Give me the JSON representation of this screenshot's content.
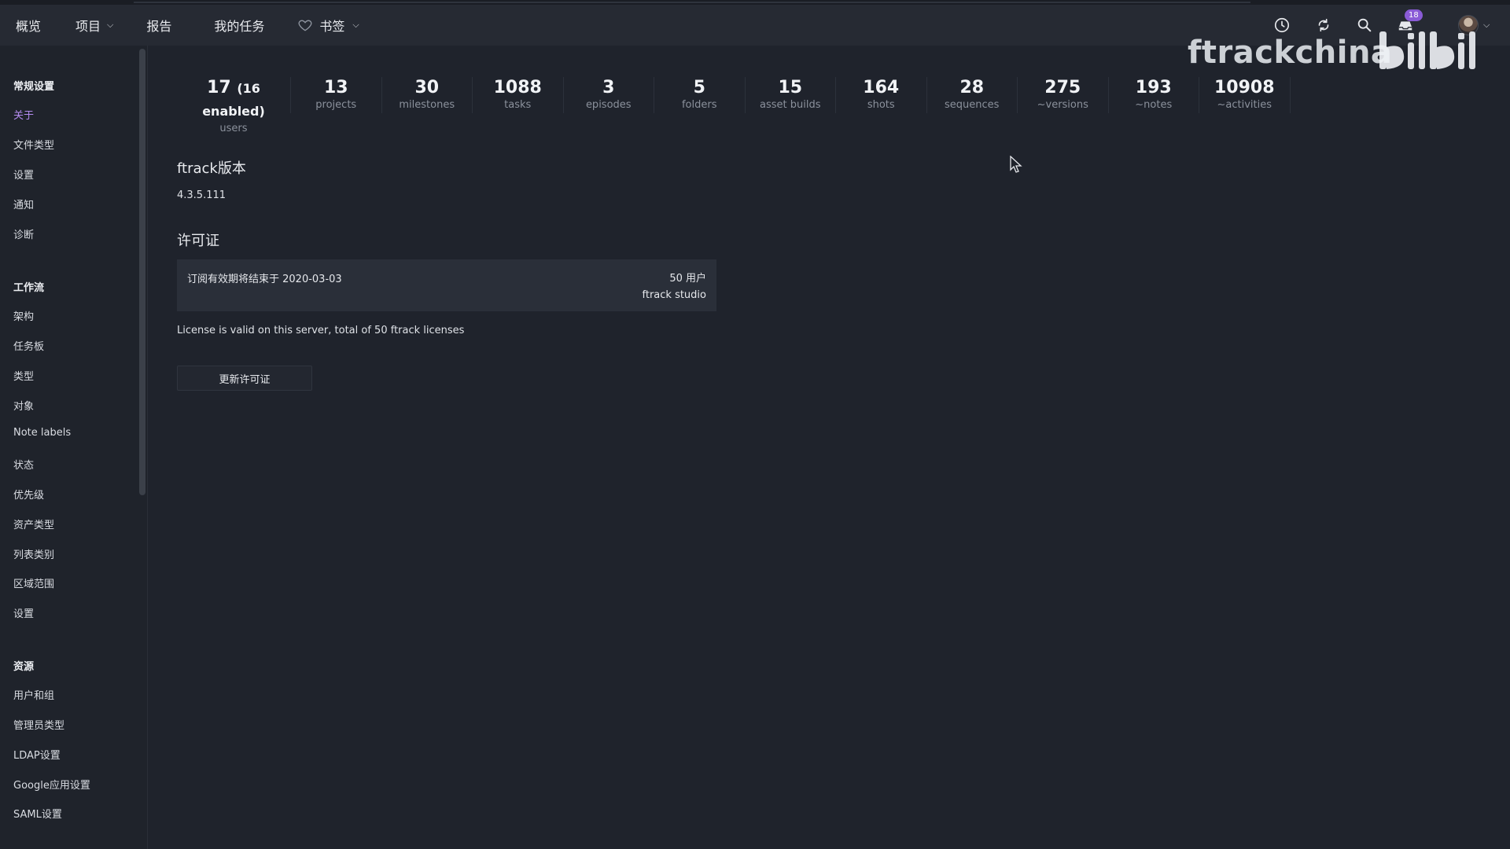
{
  "header": {
    "nav": [
      {
        "label": "概览"
      },
      {
        "label": "项目"
      },
      {
        "label": "报告"
      },
      {
        "label": "我的任务"
      },
      {
        "label": "书签"
      }
    ],
    "inbox_count": "18"
  },
  "watermark": {
    "text": "ftrackchina",
    "logo": "bilibili"
  },
  "sidebar": {
    "sections": [
      {
        "title": "常规设置",
        "items": [
          "关于",
          "文件类型",
          "设置",
          "通知",
          "诊断"
        ]
      },
      {
        "title": "工作流",
        "items": [
          "架构",
          "任务板",
          "类型",
          "对象",
          "Note labels",
          "状态",
          "优先级",
          "资产类型",
          "列表类别",
          "区域范围",
          "设置"
        ]
      },
      {
        "title": "资源",
        "items": [
          "用户和组",
          "管理员类型",
          "LDAP设置",
          "Google应用设置",
          "SAML设置"
        ]
      }
    ],
    "active_item": "关于"
  },
  "stats": [
    {
      "num": "17",
      "extra": "(16 enabled)",
      "label": "users"
    },
    {
      "num": "13",
      "label": "projects"
    },
    {
      "num": "30",
      "label": "milestones"
    },
    {
      "num": "1088",
      "label": "tasks"
    },
    {
      "num": "3",
      "label": "episodes"
    },
    {
      "num": "5",
      "label": "folders"
    },
    {
      "num": "15",
      "label": "asset builds"
    },
    {
      "num": "164",
      "label": "shots"
    },
    {
      "num": "28",
      "label": "sequences"
    },
    {
      "num": "275",
      "label": "~versions"
    },
    {
      "num": "193",
      "label": "~notes"
    },
    {
      "num": "10908",
      "label": "~activities"
    }
  ],
  "version": {
    "title": "ftrack版本",
    "value": "4.3.5.111"
  },
  "license": {
    "title": "许可证",
    "subscription": "订阅有效期将结束于 2020-03-03",
    "users": "50 用户",
    "plan": "ftrack studio",
    "note": "License is valid on this server, total of 50 ftrack licenses",
    "renew_label": "更新许可证"
  },
  "colors": {
    "background": "#1f232c",
    "header": "#262a33",
    "accent": "#b48cf0",
    "badge": "#8a5bd6"
  }
}
